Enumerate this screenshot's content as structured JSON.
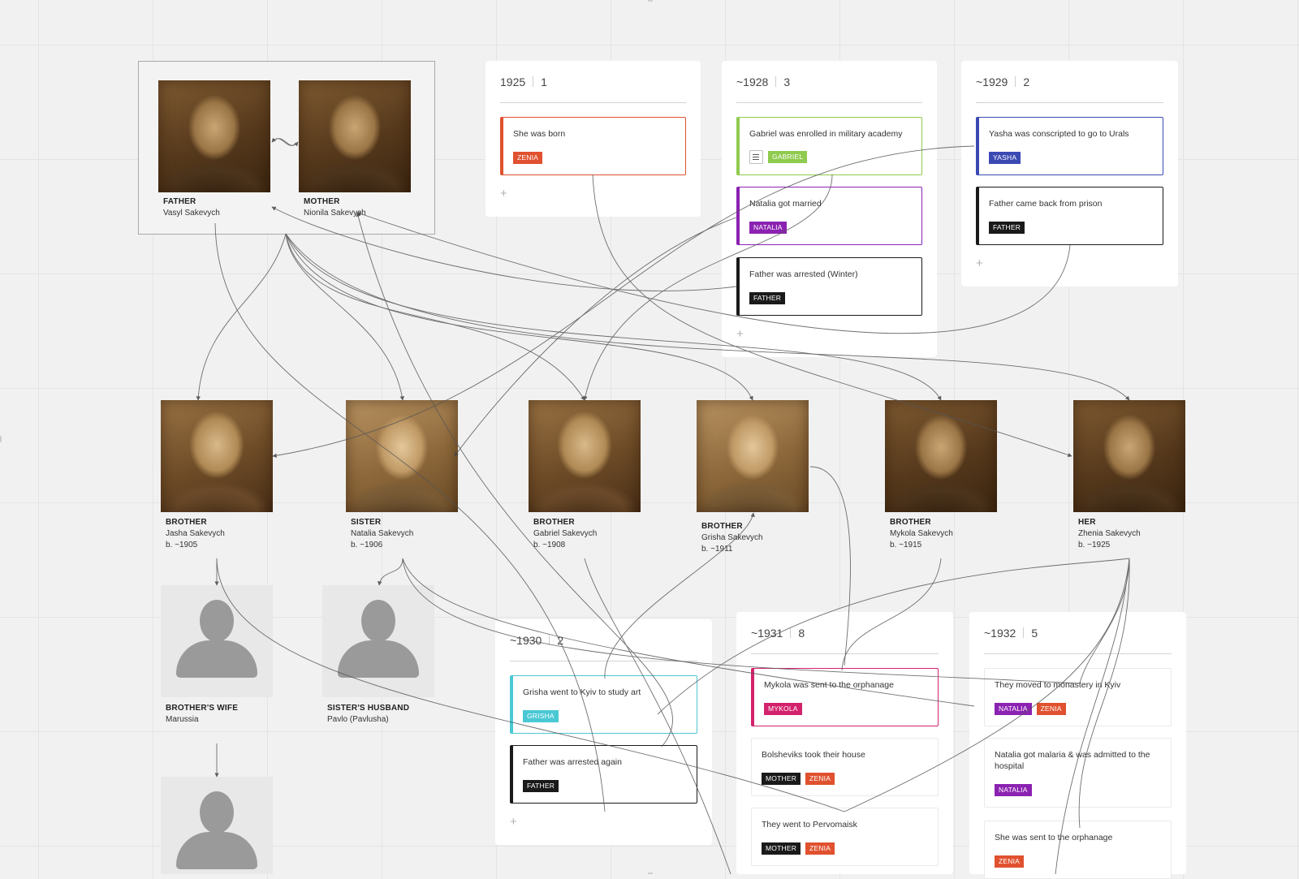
{
  "family": {
    "parents": [
      {
        "role": "FATHER",
        "name": "Vasyl Sakevych"
      },
      {
        "role": "MOTHER",
        "name": "Nionila Sakevych"
      }
    ],
    "children": [
      {
        "role": "BROTHER",
        "name": "Jasha Sakevych",
        "born": "b. ~1905"
      },
      {
        "role": "SISTER",
        "name": "Natalia Sakevych",
        "born": "b. ~1906"
      },
      {
        "role": "BROTHER",
        "name": "Gabriel Sakevych",
        "born": "b. ~1908"
      },
      {
        "role": "BROTHER",
        "name": "Grisha Sakevych",
        "born": "b. ~1911"
      },
      {
        "role": "BROTHER",
        "name": "Mykola Sakevych",
        "born": "b. ~1915"
      },
      {
        "role": "HER",
        "name": "Zhenia Sakevych",
        "born": "b. ~1925"
      }
    ],
    "spouses": [
      {
        "role": "BROTHER'S WIFE",
        "name": "Marussia"
      },
      {
        "role": "SISTER'S HUSBAND",
        "name": "Pavlo (Pavlusha)"
      }
    ]
  },
  "tag_colors": {
    "ZENIA": "#e0512f",
    "GABRIEL": "#8fcb4e",
    "NATALIA": "#8b22b1",
    "FATHER": "#1a1a1a",
    "MOTHER": "#1a1a1a",
    "YASHA": "#3b49b3",
    "GRISHA": "#4ac8d4",
    "MYKOLA": "#d3226d"
  },
  "timeline": [
    {
      "year": "1925",
      "count": "1",
      "cards": [
        {
          "text": "She was born",
          "tags": [
            "ZENIA"
          ],
          "accent": "#e0512f"
        }
      ]
    },
    {
      "year": "~1928",
      "count": "3",
      "cards": [
        {
          "text": "Gabriel was enrolled in military academy",
          "tags": [
            "GABRIEL"
          ],
          "accent": "#8fcb4e",
          "note": true
        },
        {
          "text": "Natalia got married",
          "tags": [
            "NATALIA"
          ],
          "accent": "#8b22b1"
        },
        {
          "text": "Father was arrested (Winter)",
          "tags": [
            "FATHER"
          ],
          "accent": "#1a1a1a"
        }
      ]
    },
    {
      "year": "~1929",
      "count": "2",
      "cards": [
        {
          "text": "Yasha was conscripted to go to Urals",
          "tags": [
            "YASHA"
          ],
          "accent": "#3b49b3"
        },
        {
          "text": "Father came back from prison",
          "tags": [
            "FATHER"
          ],
          "accent": "#1a1a1a"
        }
      ]
    },
    {
      "year": "~1930",
      "count": "2",
      "cards": [
        {
          "text": "Grisha went to Kyiv to study art",
          "tags": [
            "GRISHA"
          ],
          "accent": "#4ac8d4"
        },
        {
          "text": "Father was arrested again",
          "tags": [
            "FATHER"
          ],
          "accent": "#1a1a1a"
        }
      ]
    },
    {
      "year": "~1931",
      "count": "8",
      "cards": [
        {
          "text": "Mykola was sent to the orphanage",
          "tags": [
            "MYKOLA"
          ],
          "accent": "#d3226d"
        },
        {
          "text": "Bolsheviks took their house",
          "tags": [
            "MOTHER",
            "ZENIA"
          ],
          "accent": "#e6e6e6"
        },
        {
          "text": "They went to Pervomaisk",
          "tags": [
            "MOTHER",
            "ZENIA"
          ],
          "accent": "#e6e6e6"
        }
      ]
    },
    {
      "year": "~1932",
      "count": "5",
      "cards": [
        {
          "text": "They moved to monastery in Kyiv",
          "tags": [
            "NATALIA",
            "ZENIA"
          ],
          "accent": "#e6e6e6"
        },
        {
          "text": "Natalia got malaria & was admitted to the hospital",
          "tags": [
            "NATALIA"
          ],
          "accent": "#e6e6e6"
        },
        {
          "text": "She was sent to the orphanage",
          "tags": [
            "ZENIA"
          ],
          "accent": "#e6e6e6"
        }
      ]
    }
  ],
  "add_label": "+"
}
